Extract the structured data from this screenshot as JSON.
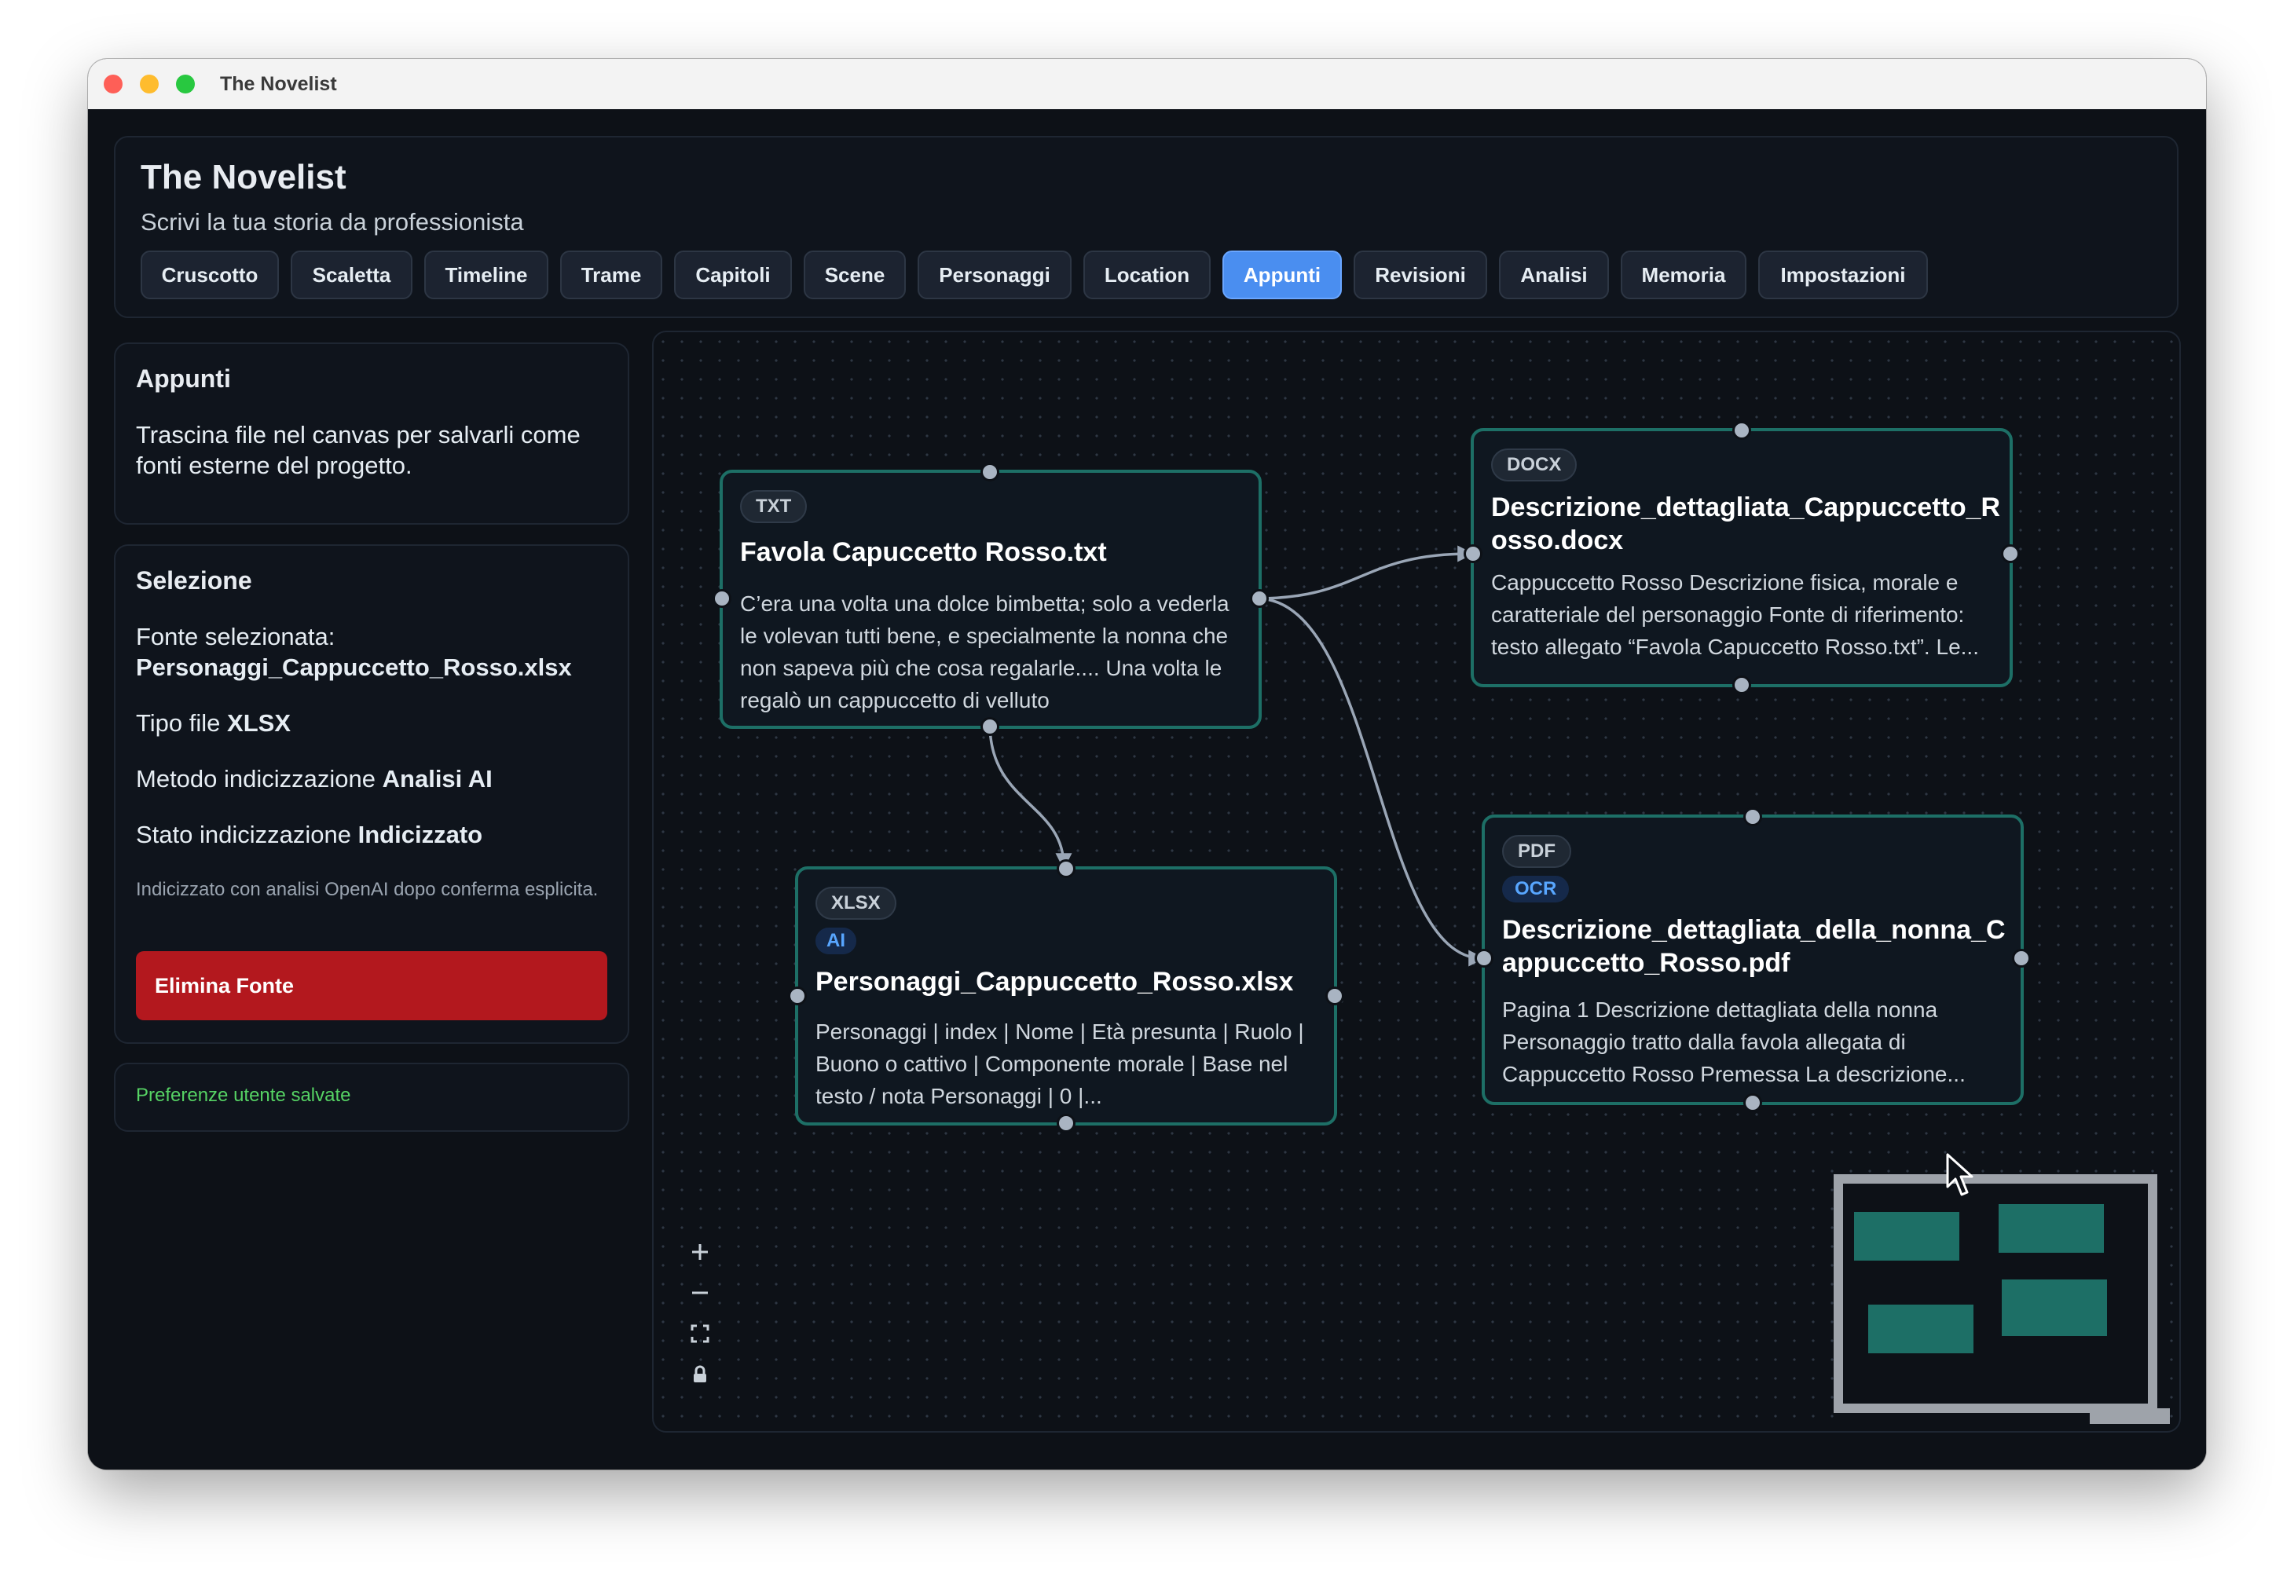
{
  "window": {
    "title": "The Novelist"
  },
  "header": {
    "title": "The Novelist",
    "subtitle": "Scrivi la tua storia da professionista",
    "tabs": [
      {
        "label": "Cruscotto"
      },
      {
        "label": "Scaletta"
      },
      {
        "label": "Timeline"
      },
      {
        "label": "Trame"
      },
      {
        "label": "Capitoli"
      },
      {
        "label": "Scene"
      },
      {
        "label": "Personaggi"
      },
      {
        "label": "Location"
      },
      {
        "label": "Appunti",
        "active": true
      },
      {
        "label": "Revisioni"
      },
      {
        "label": "Analisi"
      },
      {
        "label": "Memoria"
      },
      {
        "label": "Impostazioni"
      }
    ]
  },
  "sidebar": {
    "notes": {
      "title": "Appunti",
      "description": "Trascina file nel canvas per salvarli come fonti esterne del progetto."
    },
    "selection": {
      "title": "Selezione",
      "source_label": "Fonte selezionata:",
      "source_value": "Personaggi_Cappuccetto_Rosso.xlsx",
      "type_label": "Tipo file",
      "type_value": "XLSX",
      "method_label": "Metodo indicizzazione",
      "method_value": "Analisi AI",
      "state_label": "Stato indicizzazione",
      "state_value": "Indicizzato",
      "note": "Indicizzato con analisi OpenAI dopo conferma esplicita.",
      "delete_label": "Elimina Fonte"
    },
    "status": {
      "text": "Preferenze utente salvate"
    }
  },
  "canvas": {
    "nodes": [
      {
        "badges": [
          "TXT"
        ],
        "title": "Favola Capuccetto Rosso.txt",
        "text": "C’era una volta una dolce bimbetta; solo a vederla le volevan tutti bene, e specialmente la nonna che non sapeva più che cosa regalarle.... Una volta le regalò un cappuccetto di velluto"
      },
      {
        "badges": [
          "DOCX"
        ],
        "title": "Descrizione_dettagliata_Cappuccetto_Rosso.docx",
        "text": "Cappuccetto Rosso Descrizione fisica, morale e caratteriale del personaggio Fonte di riferimento: testo allegato “Favola Capuccetto Rosso.txt”. Le..."
      },
      {
        "badges": [
          "XLSX",
          "AI"
        ],
        "title": "Personaggi_Cappuccetto_Rosso.xlsx",
        "text": "Personaggi | index | Nome | Età presunta | Ruolo | Buono o cattivo | Componente morale | Base nel testo / nota Personaggi | 0 |..."
      },
      {
        "badges": [
          "PDF",
          "OCR"
        ],
        "title": "Descrizione_dettagliata_della_nonna_Cappuccetto_Rosso.pdf",
        "text": "Pagina 1 Descrizione dettagliata della nonna Personaggio tratto dalla favola allegata di Cappuccetto Rosso Premessa La descrizione..."
      }
    ],
    "controls": [
      "zoom-in",
      "zoom-out",
      "fit-view",
      "lock"
    ]
  },
  "colors": {
    "accent": "#4a8ef0",
    "node_border": "#1d6f66",
    "danger": "#b3181e",
    "success": "#56d364",
    "minimap_node": "#1d6f66"
  }
}
